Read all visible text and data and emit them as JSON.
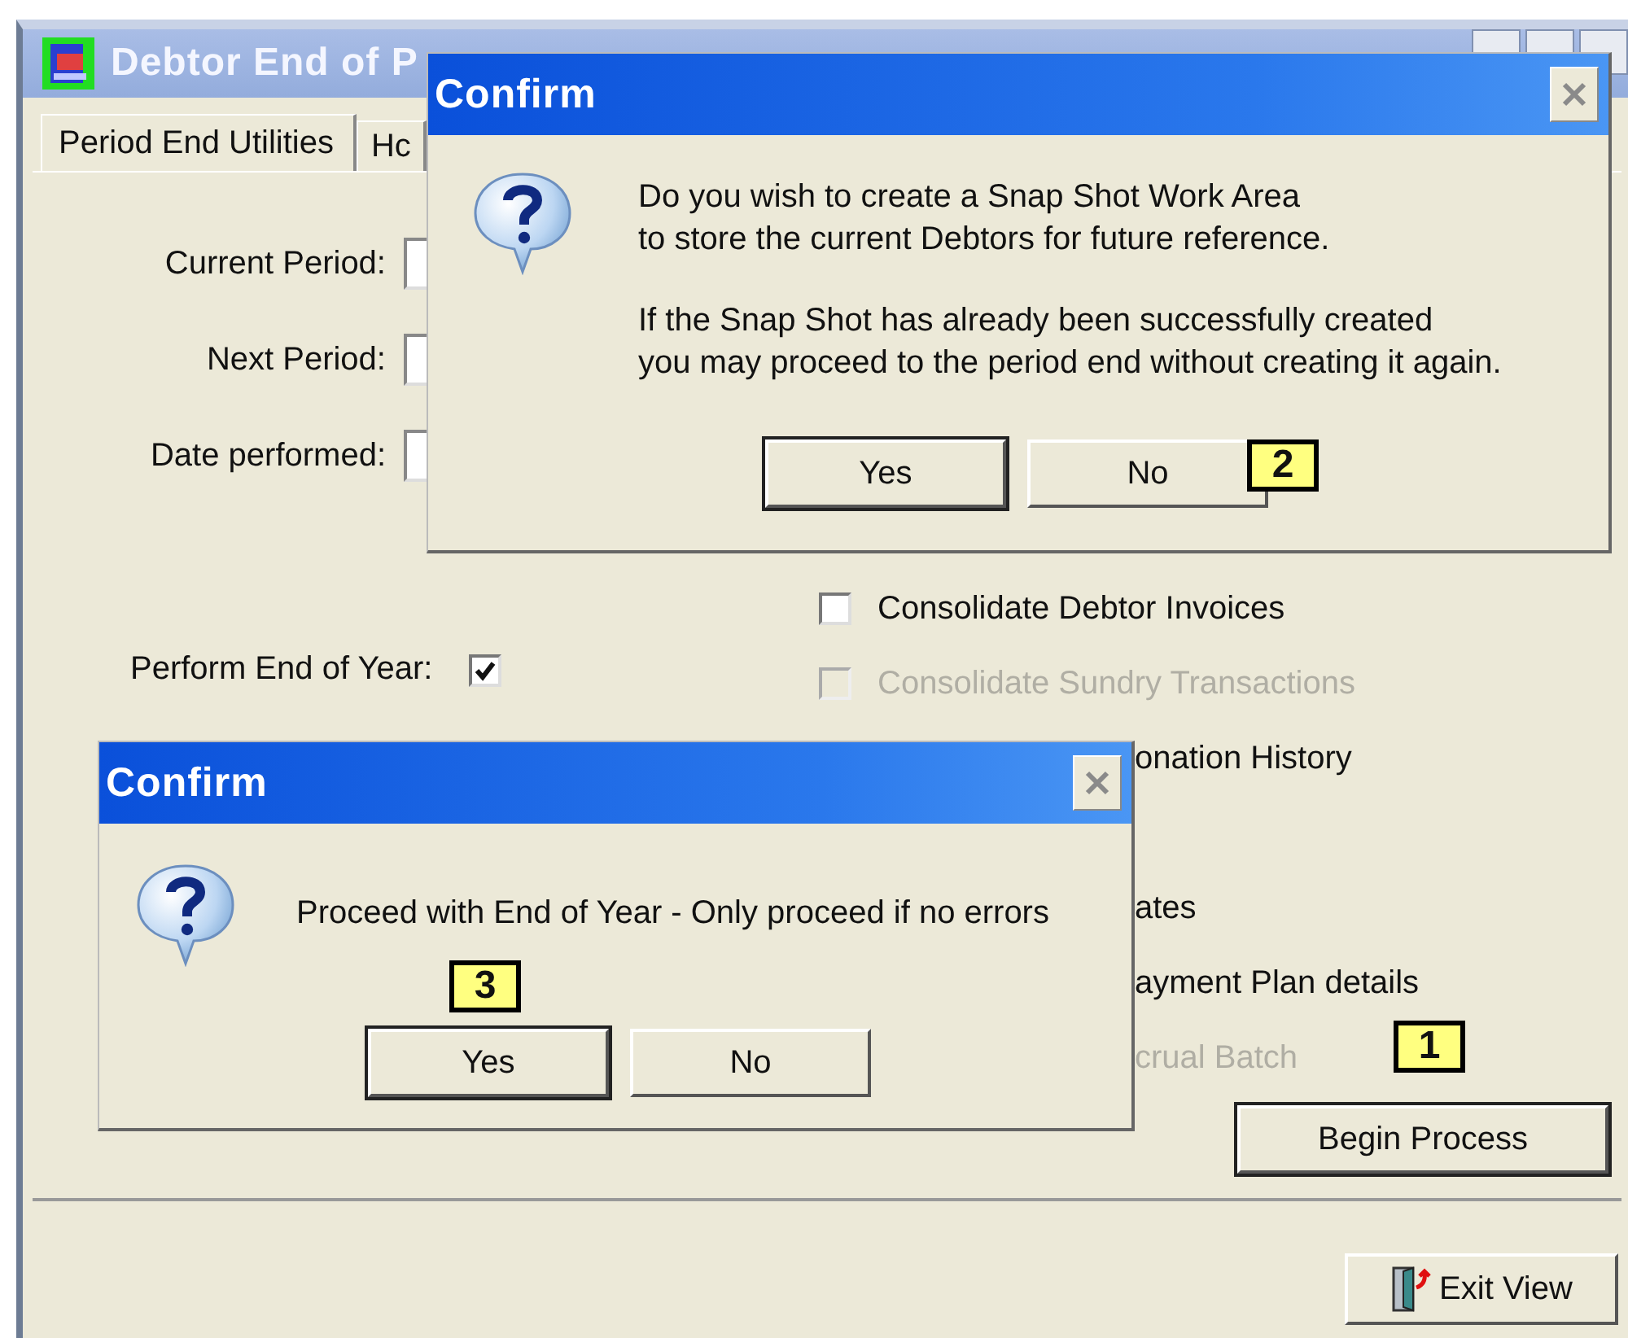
{
  "window": {
    "title": "Debtor End of P"
  },
  "tabs": [
    {
      "label": "Period End Utilities",
      "selected": true
    },
    {
      "label": "Hc",
      "selected": false
    }
  ],
  "fields": [
    {
      "label": "Current Period:"
    },
    {
      "label": "Next Period:"
    },
    {
      "label": "Date performed:"
    }
  ],
  "end_of_year": {
    "label": "Perform End of Year:",
    "checked": true
  },
  "options": [
    {
      "kind": "checkbox",
      "label": "Consolidate Debtor Invoices",
      "checked": false,
      "disabled": false
    },
    {
      "kind": "checkbox",
      "label": "Consolidate Sundry Transactions",
      "checked": false,
      "disabled": true
    },
    {
      "kind": "clipped",
      "label": "onation History",
      "disabled": false
    },
    {
      "kind": "clipped",
      "label": "ates",
      "disabled": false
    },
    {
      "kind": "clipped",
      "label": "ayment Plan details",
      "disabled": false
    },
    {
      "kind": "clipped",
      "label": "crual Batch",
      "disabled": true
    }
  ],
  "process": {
    "button": "Begin Process",
    "callout": "1"
  },
  "exit_button": "Exit View",
  "dialogs": [
    {
      "title": "Confirm",
      "paragraphs": [
        "Do you wish to create a Snap Shot Work Area\nto store the current Debtors for future reference.",
        "If the Snap Shot has already been successfully created\nyou may proceed to the period end without creating it again."
      ],
      "buttons": [
        {
          "label": "Yes",
          "default": true
        },
        {
          "label": "No",
          "default": false
        }
      ],
      "callout": "2"
    },
    {
      "title": "Confirm",
      "paragraphs": [
        "Proceed with End of Year - Only proceed if no errors"
      ],
      "buttons": [
        {
          "label": "Yes",
          "default": true
        },
        {
          "label": "No",
          "default": false
        }
      ],
      "callout": "3"
    }
  ]
}
